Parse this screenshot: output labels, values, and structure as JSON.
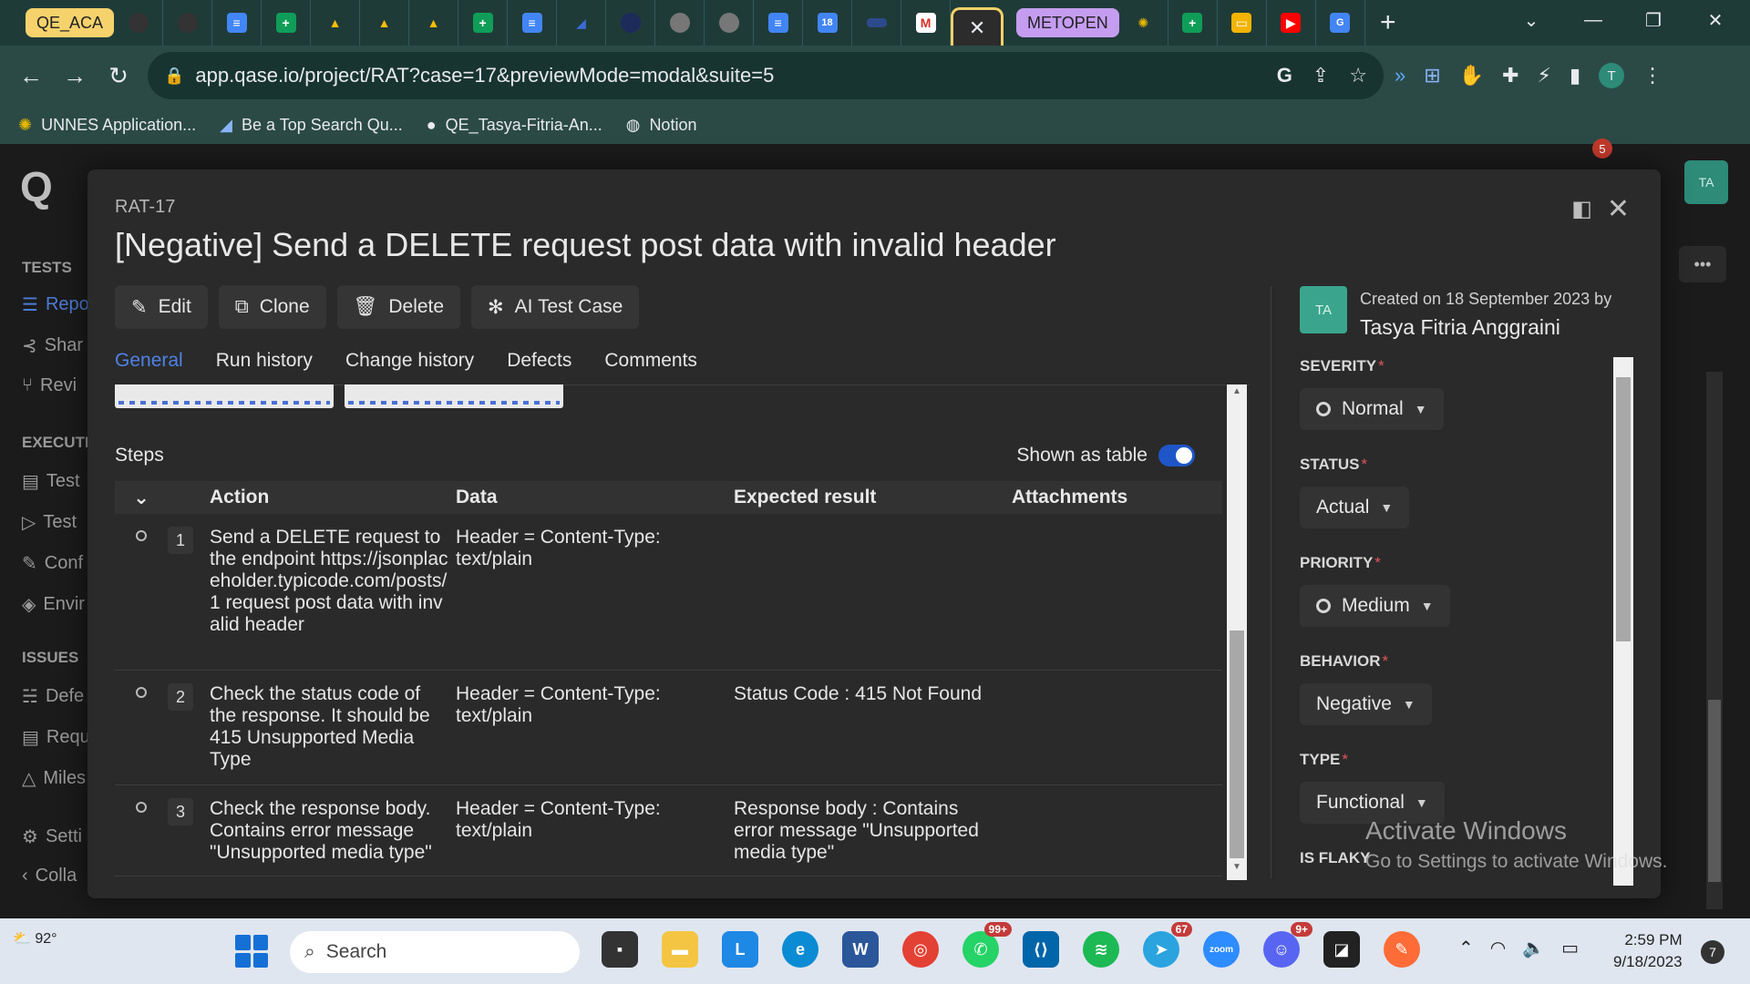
{
  "browser": {
    "tabs": [
      {
        "label": "QE_ACA",
        "color": "#f5d26b"
      },
      {
        "label": "METOPEN",
        "color": "#c59df0"
      }
    ],
    "active_tab_close": "✕",
    "url": "app.qase.io/project/RAT?case=17&previewMode=modal&suite=5",
    "bookmarks": [
      "UNNES Application...",
      "Be a Top Search Qu...",
      "QE_Tasya-Fitria-An...",
      "Notion"
    ]
  },
  "app": {
    "sidebar": {
      "sections": [
        {
          "title": "TESTS",
          "items": [
            "Repo",
            "Shar",
            "Revi"
          ]
        },
        {
          "title": "EXECUTI",
          "items": [
            "Test",
            "Test",
            "Conf",
            "Envir"
          ]
        },
        {
          "title": "ISSUES",
          "items": [
            "Defe",
            "Requ",
            "Miles"
          ]
        }
      ],
      "footer": [
        "Setti",
        "Colla"
      ]
    },
    "user_avatar": "TA",
    "notification_badge": "5"
  },
  "modal": {
    "case_code": "RAT-17",
    "title": "[Negative] Send a DELETE request post data with invalid header",
    "actions": [
      "Edit",
      "Clone",
      "Delete",
      "AI Test Case"
    ],
    "tabs": [
      "General",
      "Run history",
      "Change history",
      "Defects",
      "Comments"
    ],
    "active_tab": "General",
    "steps": {
      "label": "Steps",
      "toggle_label": "Shown as table",
      "columns": [
        "Action",
        "Data",
        "Expected result",
        "Attachments"
      ],
      "rows": [
        {
          "num": "1",
          "action": "Send a DELETE request to the endpoint https://jsonplaceholder.typicode.com/posts/1 request post data with invalid header",
          "data": "Header = Content-Type: text/plain",
          "expected": ""
        },
        {
          "num": "2",
          "action": "Check the status code of the response. It should be 415 Unsupported Media Type",
          "data": "Header = Content-Type: text/plain",
          "expected": "Status Code : 415 Not Found"
        },
        {
          "num": "3",
          "action": "Check the response body. Contains error message \"Unsupported media type\"",
          "data": "Header = Content-Type: text/plain",
          "expected": "Response body : Contains error message \"Unsupported media type\""
        }
      ]
    },
    "details": {
      "creator_initials": "TA",
      "created_on": "Created on 18 September 2023 by",
      "creator_name": "Tasya Fitria Anggraini",
      "fields": [
        {
          "label": "SEVERITY",
          "value": "Normal",
          "icon": "ring"
        },
        {
          "label": "STATUS",
          "value": "Actual",
          "icon": ""
        },
        {
          "label": "PRIORITY",
          "value": "Medium",
          "icon": "ring"
        },
        {
          "label": "BEHAVIOR",
          "value": "Negative",
          "icon": ""
        },
        {
          "label": "TYPE",
          "value": "Functional",
          "icon": ""
        },
        {
          "label": "IS FLAKY",
          "value": "",
          "icon": ""
        }
      ],
      "required_mark": "*"
    }
  },
  "watermark": {
    "title": "Activate Windows",
    "subtitle": "Go to Settings to activate Windows."
  },
  "taskbar": {
    "weather": "92°",
    "search_placeholder": "Search",
    "badges": {
      "whatsapp": "99+",
      "telegram": "67",
      "discord": "9+"
    },
    "time": "2:59 PM",
    "date": "9/18/2023",
    "notification_count": "7"
  }
}
